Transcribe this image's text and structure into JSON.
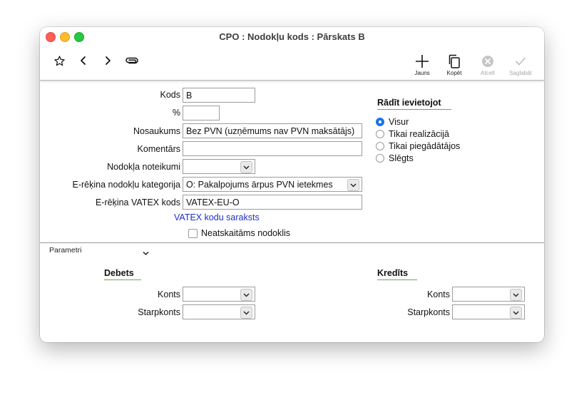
{
  "window": {
    "title": "CPO : Nodokļu kods : Pārskats B"
  },
  "toolbar": {
    "new_label": "Jauns",
    "copy_label": "Kopēt",
    "cancel_label": "Atcelt",
    "save_label": "Saglabāt"
  },
  "form": {
    "code_label": "Kods",
    "code_value": "B",
    "percent_label": "%",
    "percent_value": "",
    "name_label": "Nosaukums",
    "name_value": "Bez PVN (uzņēmums nav PVN maksātājs)",
    "comment_label": "Komentārs",
    "comment_value": "",
    "tax_rules_label": "Nodokļa noteikumi",
    "tax_rules_value": "",
    "einvoice_category_label": "E-rēķina nodokļu kategorija",
    "einvoice_category_value": "O: Pakalpojums ārpus PVN ietekmes",
    "einvoice_vatex_label": "E-rēķina VATEX kods",
    "einvoice_vatex_value": "VATEX-EU-O",
    "vatex_link": "VATEX kodu saraksts",
    "non_deductible_label": "Neatskaitāms nodoklis"
  },
  "display": {
    "heading": "Rādīt ievietojot",
    "options": [
      "Visur",
      "Tikai realizācijā",
      "Tikai piegādātājos",
      "Slēgts"
    ],
    "selected": "Visur"
  },
  "params": {
    "label": "Parametri",
    "debit": {
      "heading": "Debets",
      "account_label": "Konts",
      "account_value": "",
      "interim_label": "Starpkonts",
      "interim_value": ""
    },
    "credit": {
      "heading": "Kredīts",
      "account_label": "Konts",
      "account_value": "",
      "interim_label": "Starpkonts",
      "interim_value": ""
    }
  },
  "icons": [
    "star-icon",
    "back-icon",
    "forward-icon",
    "paperclip-icon",
    "plus-icon",
    "copy-icon",
    "cancel-icon",
    "checkmark-icon",
    "chevron-down-icon"
  ],
  "colors": {
    "accent": "#1a73e8",
    "link": "#1d2fc8",
    "section_underline": "#6aa84f"
  }
}
